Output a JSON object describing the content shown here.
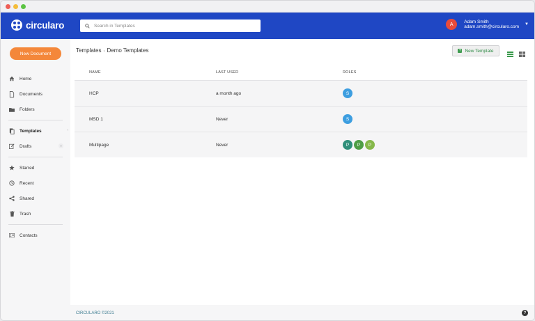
{
  "app": {
    "name": "circularo",
    "brand_color": "#1f47c4",
    "accent_color": "#f4873a"
  },
  "search": {
    "placeholder": "Search in Templates"
  },
  "user": {
    "initial": "A",
    "name": "Adam Smith",
    "email": "adam.smith@circularo.com",
    "avatar_color": "#e84b3c"
  },
  "sidebar": {
    "new_document_label": "New Document",
    "items": [
      {
        "label": "Home",
        "icon": "home-icon"
      },
      {
        "label": "Documents",
        "icon": "document-icon"
      },
      {
        "label": "Folders",
        "icon": "folder-icon"
      },
      {
        "label": "Templates",
        "icon": "templates-icon",
        "active": true
      },
      {
        "label": "Drafts",
        "icon": "drafts-icon"
      },
      {
        "label": "Starred",
        "icon": "star-icon"
      },
      {
        "label": "Recent",
        "icon": "clock-icon"
      },
      {
        "label": "Shared",
        "icon": "share-icon"
      },
      {
        "label": "Trash",
        "icon": "trash-icon"
      },
      {
        "label": "Contacts",
        "icon": "contacts-icon"
      }
    ]
  },
  "breadcrumb": {
    "parent": "Templates",
    "current": "Demo Templates"
  },
  "toolbar": {
    "new_template_label": "New Template"
  },
  "table": {
    "headers": [
      "NAME",
      "LAST USED",
      "ROLES"
    ],
    "rows": [
      {
        "name": "HCP",
        "last_used": "a month ago",
        "roles": [
          {
            "initial": "S",
            "color": "#3d9ee0"
          }
        ]
      },
      {
        "name": "MSD 1",
        "last_used": "Never",
        "roles": [
          {
            "initial": "S",
            "color": "#3d9ee0"
          }
        ]
      },
      {
        "name": "Multipage",
        "last_used": "Never",
        "roles": [
          {
            "initial": "P",
            "color": "#2f8f7a"
          },
          {
            "initial": "P",
            "color": "#4f9e45"
          },
          {
            "initial": "P",
            "color": "#86b84a"
          }
        ]
      }
    ]
  },
  "footer": {
    "copyright": "CIRCULARO ©2021",
    "help": "?"
  }
}
